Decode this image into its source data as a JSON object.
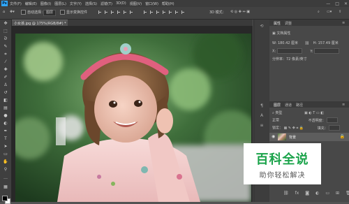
{
  "app": {
    "logo": "Ps"
  },
  "menu": [
    "文件(F)",
    "编辑(E)",
    "图像(I)",
    "图层(L)",
    "文字(Y)",
    "选择(S)",
    "滤镜(T)",
    "3D(D)",
    "视图(V)",
    "窗口(W)",
    "帮助(H)"
  ],
  "window_controls": [
    "—",
    "□",
    "✕"
  ],
  "options_bar": {
    "auto_select_label": "自动选择：",
    "auto_select_value": "图层",
    "show_transform_label": "显示变换控件"
  },
  "document": {
    "tab_title": "小女孩.jpg @ 175%(RGB/8#) *"
  },
  "tools": [
    "move-icon",
    "marquee-icon",
    "lasso-icon",
    "quick-select-icon",
    "crop-icon",
    "eyedropper-icon",
    "healing-icon",
    "brush-icon",
    "stamp-icon",
    "history-brush-icon",
    "eraser-icon",
    "gradient-icon",
    "blur-icon",
    "dodge-icon",
    "pen-icon",
    "type-icon",
    "path-select-icon",
    "shape-icon",
    "hand-icon",
    "zoom-icon"
  ],
  "properties_panel": {
    "tabs": [
      "属性",
      "调整"
    ],
    "doc_props_label": "文档属性",
    "w_label": "W:",
    "w_value": "180.42 厘米",
    "h_label": "H:",
    "h_value": "157.49 厘米",
    "x_label": "X:",
    "y_label": "Y:",
    "resolution": "分辨率：72 像素/英寸"
  },
  "layers_panel": {
    "tabs": [
      "图层",
      "通道",
      "路径"
    ],
    "kind_label": "类型",
    "blend_mode": "正常",
    "opacity_label": "不透明度：",
    "lock_label": "锁定：",
    "fill_label": "填充：",
    "layer_name": "背景"
  },
  "watermark": {
    "line1": "百科全说",
    "line2": "助你轻松解决"
  },
  "colors": {
    "foreground": "#000000",
    "background": "#ffffff",
    "accent": "#31a8ff"
  }
}
